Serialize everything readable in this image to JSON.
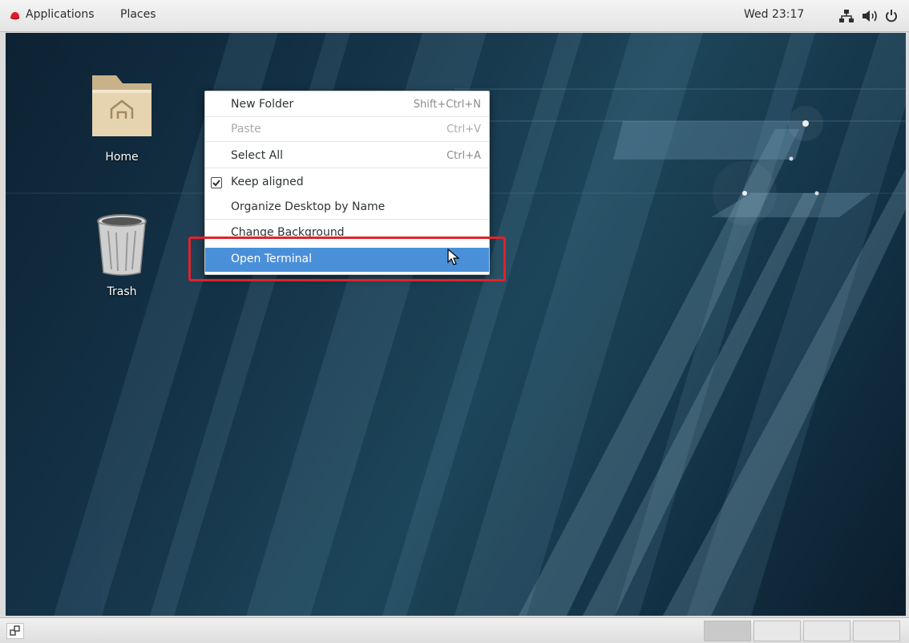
{
  "top_panel": {
    "applications_label": "Applications",
    "places_label": "Places",
    "clock": "Wed 23:17",
    "icons": [
      "redhat-logo-icon",
      "network-icon",
      "volume-icon",
      "power-icon"
    ]
  },
  "desktop": {
    "icons": [
      {
        "label": "Home",
        "icon": "home-folder-icon"
      },
      {
        "label": "Trash",
        "icon": "trash-icon"
      }
    ]
  },
  "context_menu": {
    "items": [
      {
        "label": "New Folder",
        "accel": "Shift+Ctrl+N",
        "enabled": true
      },
      {
        "label": "Paste",
        "accel": "Ctrl+V",
        "enabled": false
      },
      {
        "label": "Select All",
        "accel": "Ctrl+A",
        "enabled": true
      },
      {
        "label": "Keep aligned",
        "checked": true
      },
      {
        "label": "Organize Desktop by Name"
      },
      {
        "label": "Change Background"
      },
      {
        "label": "Open Terminal",
        "highlighted": true
      }
    ]
  },
  "bottom_panel": {
    "workspaces": 4,
    "active_workspace": 1
  },
  "colors": {
    "menu_highlight": "#4a90d9",
    "annotation_box": "#e0232a",
    "redhat_red": "#ee0000"
  }
}
